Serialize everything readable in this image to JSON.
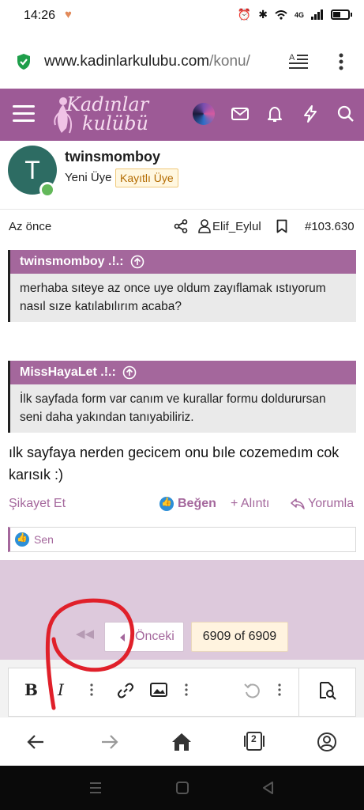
{
  "status_bar": {
    "time": "14:26",
    "network": "4G"
  },
  "browser": {
    "url_host": "www.kadinlarkulubu.com",
    "url_path": "/konu/"
  },
  "site": {
    "logo_line1": "Kadınlar",
    "logo_line2": "kulübü",
    "brand_color": "#9d5a96"
  },
  "post": {
    "avatar_letter": "T",
    "username": "twinsmomboy",
    "user_title": "Yeni Üye",
    "user_badge": "Kayıtlı Üye",
    "time": "Az önce",
    "recipient": "Elif_Eylul",
    "post_number": "#103.630",
    "quotes": [
      {
        "author": "twinsmomboy .!.:",
        "text": "merhaba sıteye az once uye oldum zayıflamak ıstıyorum nasıl sıze katılabılırım acaba?"
      },
      {
        "author": "MissHayaLet .!.:",
        "text": "İlk sayfada form var canım ve kurallar formu doldurursan seni daha yakından tanıyabiliriz."
      }
    ],
    "reply": "ılk sayfaya nerden gecicem onu bıle cozemedım cok karısık :)",
    "actions": {
      "report": "Şikayet Et",
      "like": "Beğen",
      "quote": "+ Alıntı",
      "reply": "Yorumla"
    },
    "reactions": "Sen"
  },
  "pager": {
    "prev_label": "Önceki",
    "position": "6909 of 6909"
  },
  "editor": {
    "bold": "B",
    "italic": "I"
  },
  "browser_nav": {
    "tab_count": "2"
  }
}
